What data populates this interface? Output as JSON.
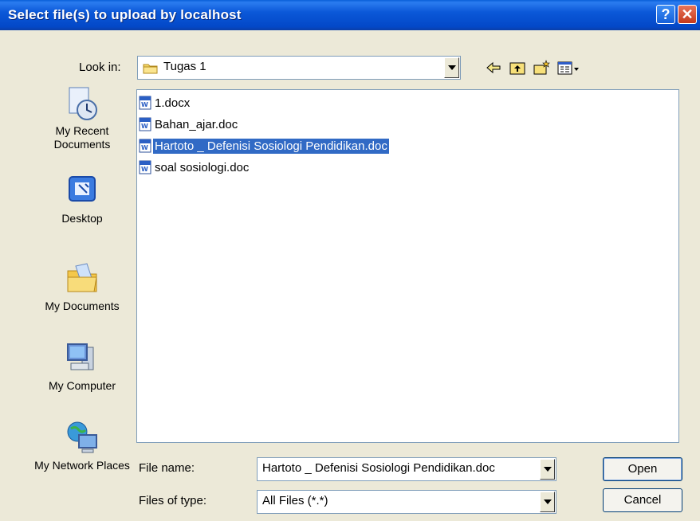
{
  "window": {
    "title": "Select file(s) to upload by localhost",
    "help_glyph": "?",
    "close_glyph": "✕"
  },
  "lookin": {
    "label": "Look in:",
    "value": "Tugas 1"
  },
  "toolbar": {
    "icons": [
      "back-icon",
      "up-folder-icon",
      "new-folder-icon",
      "views-menu-icon"
    ]
  },
  "places": [
    {
      "label": "My Recent Documents",
      "icon": "recent-documents-icon"
    },
    {
      "label": "Desktop",
      "icon": "desktop-icon"
    },
    {
      "label": "My Documents",
      "icon": "my-documents-icon"
    },
    {
      "label": "My Computer",
      "icon": "my-computer-icon"
    },
    {
      "label": "My Network Places",
      "icon": "network-places-icon"
    }
  ],
  "files": [
    {
      "name": "1.docx",
      "selected": false
    },
    {
      "name": "Bahan_ajar.doc",
      "selected": false
    },
    {
      "name": "Hartoto _ Defenisi Sosiologi Pendidikan.doc",
      "selected": true
    },
    {
      "name": "soal sosiologi.doc",
      "selected": false
    }
  ],
  "filename": {
    "label": "File name:",
    "value": "Hartoto _ Defenisi Sosiologi Pendidikan.doc"
  },
  "filetype": {
    "label": "Files of type:",
    "value": "All Files (*.*)"
  },
  "buttons": {
    "open": "Open",
    "cancel": "Cancel"
  },
  "colors": {
    "titlebar": "#0348c8",
    "selection": "#316ac5",
    "dialog_bg": "#ece9d8"
  }
}
